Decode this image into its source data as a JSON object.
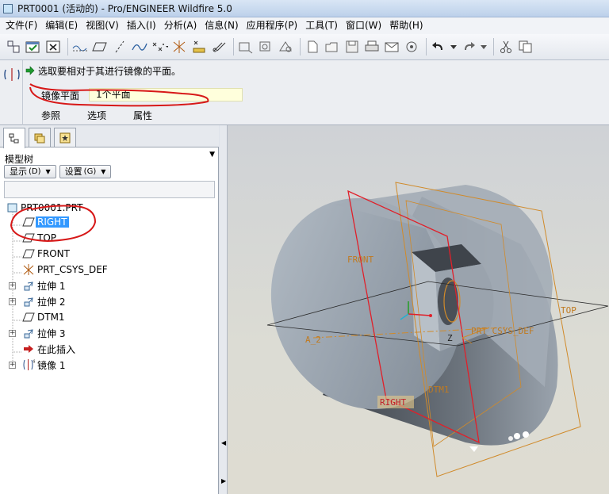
{
  "window": {
    "title": "PRT0001 (活动的) - Pro/ENGINEER Wildfire 5.0"
  },
  "menu": {
    "items": [
      {
        "label": "文件(F)"
      },
      {
        "label": "编辑(E)"
      },
      {
        "label": "视图(V)"
      },
      {
        "label": "插入(I)"
      },
      {
        "label": "分析(A)"
      },
      {
        "label": "信息(N)"
      },
      {
        "label": "应用程序(P)"
      },
      {
        "label": "工具(T)"
      },
      {
        "label": "窗口(W)"
      },
      {
        "label": "帮助(H)"
      }
    ]
  },
  "toolbar": {
    "icons": [
      "regenerate-icon",
      "ok-check-icon",
      "cancel-x-icon",
      "datum-axis-icon",
      "datum-plane-icon",
      "datum-line-icon",
      "curve-icon",
      "datum-point-icon",
      "coordinate-system-icon",
      "analysis-icon",
      "sketch-icon",
      "undo-icon",
      "redo-icon",
      "cut-icon",
      "copy-icon"
    ]
  },
  "dashboard": {
    "prompt": "选取要相对于其进行镜像的平面。",
    "mirror_plane_label": "镜像平面",
    "mirror_plane_value": "1个平面",
    "tabs": [
      {
        "label": "参照"
      },
      {
        "label": "选项"
      },
      {
        "label": "属性"
      }
    ]
  },
  "panel": {
    "title": "模型树",
    "show_button": "显示",
    "show_button_hotkey": "(D)",
    "settings_button": "设置",
    "settings_button_hotkey": "(G)"
  },
  "tree": {
    "root": "PRT0001.PRT",
    "items": [
      {
        "label": "RIGHT",
        "selected": true,
        "icon": "datum-plane-icon"
      },
      {
        "label": "TOP",
        "icon": "datum-plane-icon"
      },
      {
        "label": "FRONT",
        "icon": "datum-plane-icon"
      },
      {
        "label": "PRT_CSYS_DEF",
        "icon": "coordinate-system-icon"
      },
      {
        "label": "拉伸 1",
        "icon": "extrude-icon"
      },
      {
        "label": "拉伸 2",
        "icon": "extrude-icon"
      },
      {
        "label": "DTM1",
        "icon": "datum-plane-icon"
      },
      {
        "label": "拉伸 3",
        "icon": "extrude-icon"
      },
      {
        "label": "在此插入",
        "icon": "insert-here-arrow-icon"
      },
      {
        "label": "镜像 1",
        "icon": "mirror-icon"
      }
    ]
  },
  "viewport": {
    "labels": {
      "front": "FRONT",
      "top": "TOP",
      "right": "RIGHT",
      "dtm1": "DTM1",
      "csys": "PRT_CSYS_DEF",
      "axis": "A_2",
      "z": "Z"
    },
    "colors": {
      "background": "#d6d6d0",
      "model": "#9aa3ad",
      "datum": "#d08a2a",
      "selected": "#e0202a"
    }
  }
}
